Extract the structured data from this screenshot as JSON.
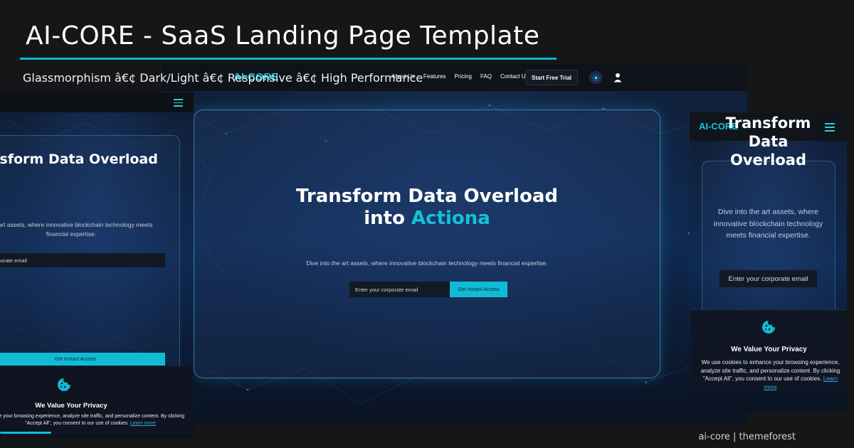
{
  "banner": {
    "title": "AI-CORE - SaaS Landing Page Template",
    "subtitle": "Glassmorphism â€¢ Dark/Light â€¢ Responsive â€¢ High Performance",
    "credit": "ai-core | themeforest",
    "accent_color": "#12b5c9"
  },
  "desktop": {
    "logo": "AI-CORE",
    "nav_links": [
      "About Us",
      "Features",
      "Pricing",
      "FAQ",
      "Contact Us"
    ],
    "cta": "Start Free Trial",
    "theme_toggle_icon": "sun-icon",
    "user_icon": "user-icon",
    "hero": {
      "title_line1": "Transform Data Overload",
      "title_line2_prefix": "into ",
      "title_line2_accent": "Actiona",
      "description": "Dive into the art assets, where innovative blockchain technology meets financial expertise.",
      "email_placeholder": "Enter your corporate email",
      "button": "Get Instant Access"
    }
  },
  "tablet": {
    "title": "nsform Data Overload",
    "description": "he art assets, where innovative blockchain technology meets financial expertise.",
    "email_placeholder": "orporate email",
    "button": "Get Instant Access",
    "cookie": {
      "heading": "We Value Your Privacy",
      "text": "ce your browsing experience, analyze site traffic, and personalize content. By clicking \"Accept All\", you consent to our use of cookies.",
      "learn_more": "Learn more"
    }
  },
  "phone": {
    "logo": "AI-CORE",
    "title": "Transform Data Overload",
    "description": "Dive into the art assets, where innovative blockchain technology meets financial expertise.",
    "email_placeholder": "Enter your corporate email",
    "cookie": {
      "heading": "We Value Your Privacy",
      "text": "We use cookies to enhance your browsing experience, analyze site traffic, and personalize content. By clicking \"Accept All\", you consent to our use of cookies.",
      "learn_more": "Learn more"
    }
  },
  "colors": {
    "accent": "#10bcd4",
    "background": "#141618",
    "card_border": "#50c8e6"
  }
}
